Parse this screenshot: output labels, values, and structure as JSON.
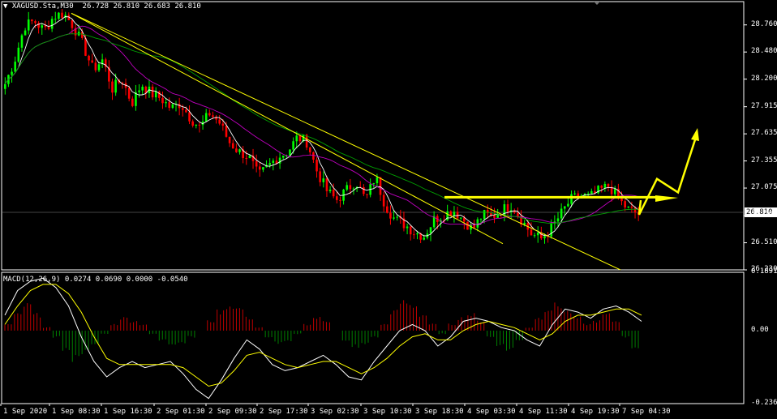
{
  "chart_title": "XAGUSD.Sta,M30",
  "ohlc": "26.728 26.810 26.683 26.810",
  "current_price": "26.810",
  "macd_label": "MACD(12,26,9) 0.0274 0.0690 0.0000 -0.0540",
  "colors": {
    "background": "#000000",
    "bull": "#00ff00",
    "bear": "#ff0000",
    "trendline": "#ffff00",
    "ma_fast": "#ffffff",
    "ma_mid": "#c000c0",
    "ma_slow": "#00a000",
    "macd_pos": "#c00000",
    "macd_neg": "#008000"
  },
  "chart_data": [
    {
      "type": "candlestick",
      "symbol": "XAGUSD.Sta",
      "timeframe": "M30",
      "ylim": [
        26.23,
        28.9
      ],
      "yticks": [
        28.76,
        28.48,
        28.2,
        27.915,
        27.635,
        27.355,
        27.075,
        26.79,
        26.51,
        26.23
      ],
      "x_tick_labels": [
        "1 Sep 2020",
        "1 Sep 08:30",
        "1 Sep 16:30",
        "2 Sep 01:30",
        "2 Sep 09:30",
        "2 Sep 17:30",
        "3 Sep 02:30",
        "3 Sep 10:30",
        "3 Sep 18:30",
        "4 Sep 03:30",
        "4 Sep 11:30",
        "4 Sep 19:30",
        "7 Sep 04:30"
      ],
      "close_path": [
        28.15,
        28.4,
        28.75,
        28.8,
        28.7,
        28.85,
        28.88,
        28.75,
        28.55,
        28.3,
        28.4,
        28.1,
        28.2,
        27.95,
        28.15,
        28.05,
        28.0,
        27.9,
        27.95,
        27.8,
        27.7,
        27.85,
        27.75,
        27.55,
        27.45,
        27.4,
        27.2,
        27.3,
        27.4,
        27.45,
        27.6,
        27.55,
        27.25,
        27.05,
        26.95,
        27.05,
        27.15,
        26.95,
        27.2,
        26.9,
        26.75,
        26.7,
        26.62,
        26.58,
        26.75,
        26.8,
        26.85,
        26.75,
        26.65,
        26.8,
        26.78,
        26.85,
        26.9,
        26.75,
        26.6,
        26.55,
        26.65,
        26.8,
        26.95,
        27.0,
        26.98,
        27.05,
        27.1,
        26.95,
        26.85,
        26.81
      ],
      "trendlines": [
        {
          "from": [
            "1 Sep 08:30",
            28.88
          ],
          "to": [
            "4 Sep 19:30",
            26.23
          ]
        },
        {
          "from": [
            "1 Sep 08:30",
            28.88
          ],
          "to": [
            "4 Sep 11:30",
            26.5
          ]
        },
        {
          "from": [
            "3 Sep 18:30",
            26.98
          ],
          "to": [
            "7 Sep 04:30",
            26.98
          ]
        }
      ],
      "projection_arrow": [
        26.8,
        27.17,
        27.03,
        27.6
      ]
    },
    {
      "type": "bar",
      "name": "MACD(12,26,9)",
      "ylim": [
        -0.2366,
        0.1891
      ],
      "yticks": [
        0.1891,
        0.0,
        -0.2366
      ],
      "histogram": [
        0.02,
        0.05,
        0.08,
        0.05,
        0.01,
        -0.02,
        -0.06,
        -0.09,
        -0.07,
        -0.04,
        -0.01,
        0.02,
        0.04,
        0.03,
        0.02,
        -0.01,
        -0.03,
        -0.05,
        -0.04,
        -0.02,
        0.0,
        0.03,
        0.06,
        0.08,
        0.07,
        0.04,
        0.01,
        -0.02,
        -0.04,
        -0.03,
        -0.01,
        0.02,
        0.04,
        0.03,
        0.0,
        -0.03,
        -0.05,
        -0.04,
        -0.02,
        0.02,
        0.06,
        0.09,
        0.08,
        0.05,
        0.02,
        -0.01,
        0.02,
        0.04,
        0.05,
        0.03,
        -0.02,
        -0.05,
        -0.06,
        -0.03,
        0.01,
        0.04,
        0.07,
        0.08,
        0.06,
        0.04,
        0.02,
        0.03,
        0.05,
        0.03,
        -0.02,
        -0.06
      ],
      "macd_line": [
        0.05,
        0.13,
        0.16,
        0.17,
        0.14,
        0.08,
        -0.02,
        -0.1,
        -0.15,
        -0.12,
        -0.1,
        -0.12,
        -0.11,
        -0.1,
        -0.14,
        -0.19,
        -0.22,
        -0.16,
        -0.09,
        -0.03,
        -0.06,
        -0.11,
        -0.13,
        -0.12,
        -0.1,
        -0.08,
        -0.11,
        -0.15,
        -0.16,
        -0.1,
        -0.05,
        0.0,
        0.02,
        0.0,
        -0.05,
        -0.02,
        0.03,
        0.04,
        0.03,
        0.01,
        0.0,
        -0.03,
        -0.05,
        0.02,
        0.07,
        0.06,
        0.04,
        0.07,
        0.08,
        0.06,
        0.03
      ],
      "signal_line": [
        0.02,
        0.08,
        0.13,
        0.15,
        0.15,
        0.12,
        0.06,
        -0.02,
        -0.09,
        -0.11,
        -0.11,
        -0.11,
        -0.11,
        -0.11,
        -0.12,
        -0.15,
        -0.18,
        -0.17,
        -0.13,
        -0.08,
        -0.07,
        -0.09,
        -0.11,
        -0.12,
        -0.11,
        -0.1,
        -0.1,
        -0.12,
        -0.14,
        -0.12,
        -0.09,
        -0.05,
        -0.02,
        -0.01,
        -0.03,
        -0.03,
        0.0,
        0.02,
        0.03,
        0.02,
        0.01,
        -0.01,
        -0.03,
        -0.01,
        0.03,
        0.05,
        0.05,
        0.06,
        0.07,
        0.07,
        0.05
      ]
    }
  ]
}
